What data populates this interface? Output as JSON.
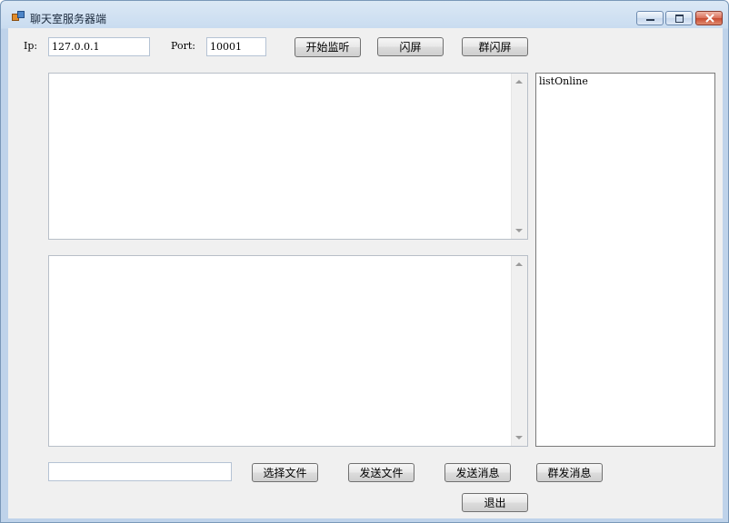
{
  "window": {
    "title": "聊天室服务器端"
  },
  "connection": {
    "ip_label": "Ip:",
    "ip_value": "127.0.0.1",
    "port_label": "Port:",
    "port_value": "10001"
  },
  "toolbar": {
    "start_listen": "开始监听",
    "shake": "闪屏",
    "group_shake": "群闪屏"
  },
  "online_list": {
    "items": [
      "listOnline"
    ]
  },
  "bottom": {
    "file_path_value": "",
    "choose_file": "选择文件",
    "send_file": "发送文件",
    "send_message": "发送消息",
    "broadcast_message": "群发消息",
    "exit": "退出"
  }
}
